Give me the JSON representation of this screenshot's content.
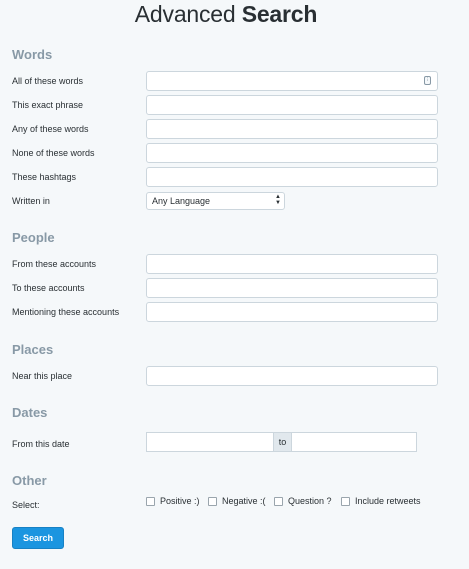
{
  "title": {
    "light": "Advanced",
    "bold": "Search"
  },
  "words": {
    "heading": "Words",
    "all_label": "All of these words",
    "exact_label": "This exact phrase",
    "any_label": "Any of these words",
    "none_label": "None of these words",
    "hashtags_label": "These hashtags",
    "written_label": "Written in",
    "language_value": "Any Language",
    "all_value": "",
    "exact_value": "",
    "any_value": "",
    "none_value": "",
    "hashtags_value": ""
  },
  "people": {
    "heading": "People",
    "from_label": "From these accounts",
    "to_label": "To these accounts",
    "mention_label": "Mentioning these accounts",
    "from_value": "",
    "to_value": "",
    "mention_value": ""
  },
  "places": {
    "heading": "Places",
    "near_label": "Near this place",
    "near_value": ""
  },
  "dates": {
    "heading": "Dates",
    "from_label": "From this date",
    "to_text": "to",
    "from_value": "",
    "to_value": ""
  },
  "other": {
    "heading": "Other",
    "select_label": "Select:",
    "options": [
      {
        "label": "Positive :)",
        "checked": false
      },
      {
        "label": "Negative :(",
        "checked": false
      },
      {
        "label": "Question ?",
        "checked": false
      },
      {
        "label": "Include retweets",
        "checked": false
      }
    ]
  },
  "search_button": "Search",
  "icons": {
    "field_icon": "keyboard-icon",
    "select_arrows": "updown-arrows-icon"
  }
}
